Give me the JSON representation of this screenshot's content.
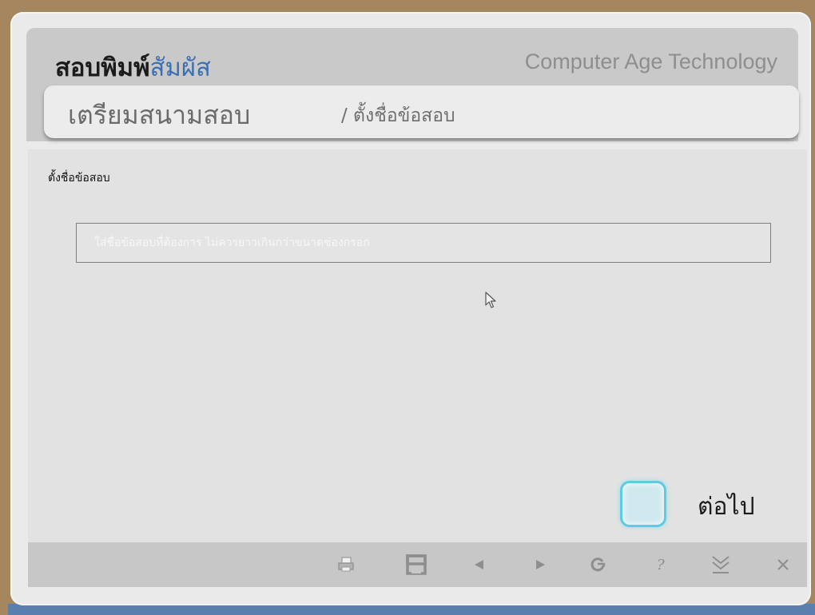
{
  "app": {
    "title_dark": "สอบพิมพ์",
    "title_blue": "สัมผัส",
    "brand": "Computer Age Technology"
  },
  "banner": {
    "main": "เตรียมสนามสอบ",
    "sub": "/ ตั้งชื่อข้อสอบ"
  },
  "form": {
    "label": "ตั้งชื่อข้อสอบ",
    "exam_name_placeholder": "ใส่ชื่อข้อสอบที่ต้องการ ไม่ควรยาวเกินกว่าขนาดช่องกรอก"
  },
  "next": {
    "label": "ต่อไป"
  },
  "toolbar": {
    "icons": [
      "print-icon",
      "save-icon",
      "back-icon",
      "forward-icon",
      "refresh-icon",
      "help-icon",
      "minimize-icon",
      "close-icon"
    ]
  },
  "colors": {
    "accent_blue": "#3b6fb2",
    "next_button_border": "#5ecbe0",
    "window_bg": "#eaeaea",
    "toolbar_bg": "#c7c7c7"
  }
}
